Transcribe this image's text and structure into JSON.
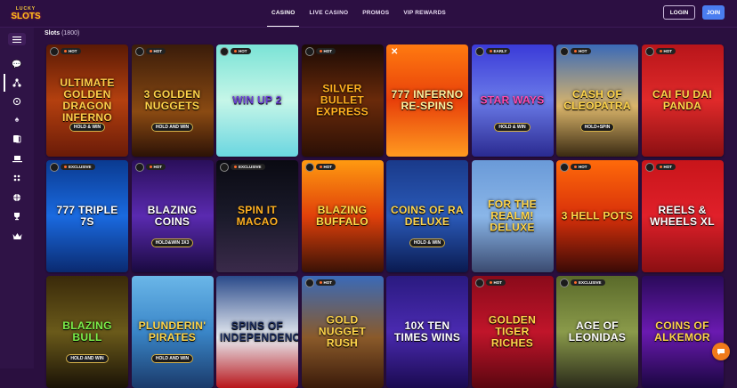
{
  "logo": {
    "line1": "LUCKY",
    "line2": "SLOTS"
  },
  "nav": {
    "items": [
      "CASINO",
      "LIVE CASINO",
      "PROMOS",
      "VIP REWARDS"
    ]
  },
  "auth": {
    "login": "LOGIN",
    "join": "JOIN"
  },
  "sidebar": {
    "icons": [
      "menu-icon",
      "chat-bubbles-icon",
      "slots-tree-icon",
      "ball-icon",
      "spade-icon",
      "cards-icon",
      "laptop-icon",
      "dice-icon",
      "basketball-icon",
      "trophy-icon",
      "crown-icon"
    ]
  },
  "section": {
    "title": "Slots",
    "count": "(1800)"
  },
  "tiles": [
    {
      "title": "Ultimate Golden Dragon Inferno",
      "sub": "HOLD & WIN",
      "tag": "HOT",
      "bg": "linear-gradient(180deg,#5a1a05,#b4400f 50%,#6a1b08)",
      "color": "#ffcf4a"
    },
    {
      "title": "3 Golden Nuggets",
      "sub": "HOLD AND WIN",
      "tag": "HOT",
      "bg": "linear-gradient(180deg,#3a1c0a,#8a4a12 60%,#2c1206)",
      "color": "#ffd54a"
    },
    {
      "title": "Win Up 2",
      "sub": "",
      "tag": "HOT",
      "bg": "linear-gradient(180deg,#7ae3d6,#c6f6e8 50%,#6ad6e0)",
      "color": "#6a3fd8"
    },
    {
      "title": "Silver Bullet Express",
      "sub": "",
      "tag": "HOT",
      "bg": "linear-gradient(180deg,#1a0a05,#6a2a0a 50%,#2a0f05)",
      "color": "#ffb020"
    },
    {
      "title": "777 Inferno Re-Spins",
      "sub": "",
      "tag": "",
      "bg": "linear-gradient(180deg,#ff7a10,#e8400a 50%,#ff9a20)",
      "color": "#fff2a0"
    },
    {
      "title": "Star Ways",
      "sub": "HOLD & WIN",
      "tag": "EARLY",
      "bg": "linear-gradient(180deg,#3a3ad8,#6a7ae8 50%,#2a2a90)",
      "color": "#ff4ab0"
    },
    {
      "title": "Cash of Cleopatra",
      "sub": "HOLD+SPIN",
      "tag": "HOT",
      "bg": "linear-gradient(180deg,#3a6ab8,#d9b46a 55%,#3a2a12)",
      "color": "#ffd54a"
    },
    {
      "title": "Cai Fu Dai Panda",
      "sub": "",
      "tag": "HOT",
      "bg": "linear-gradient(180deg,#b8151a,#e02a2a 50%,#8a0f12)",
      "color": "#ffd54a"
    },
    {
      "title": "777 Triple 7s",
      "sub": "",
      "tag": "EXCLUSIVE",
      "bg": "linear-gradient(180deg,#0a3a90,#1a6ae0 50%,#0a2a70)",
      "color": "#ffffff"
    },
    {
      "title": "Blazing Coins",
      "sub": "HOLD&WIN 3X3",
      "tag": "HOT",
      "bg": "linear-gradient(180deg,#2a0f5a,#5a2ab0 50%,#1a0a40)",
      "color": "#ffffff"
    },
    {
      "title": "Spin It Macao",
      "sub": "",
      "tag": "EXCLUSIVE",
      "bg": "linear-gradient(180deg,#0a0a12,#1a1a2a 50%,#3a2a4a)",
      "color": "#ffb020"
    },
    {
      "title": "Blazing Buffalo",
      "sub": "",
      "tag": "HOT",
      "bg": "linear-gradient(180deg,#ff9a10,#e0400a 50%,#3a1206)",
      "color": "#ffdf4a"
    },
    {
      "title": "Coins of Ra Deluxe",
      "sub": "HOLD & WIN",
      "tag": "",
      "bg": "linear-gradient(180deg,#1a3a8a,#2a5ab8 50%,#0a1a50)",
      "color": "#ffd54a"
    },
    {
      "title": "For the Realm! Deluxe",
      "sub": "",
      "tag": "",
      "bg": "linear-gradient(180deg,#6a9ad8,#8ab6e8 50%,#3a4a70)",
      "color": "#ffd54a"
    },
    {
      "title": "3 Hell Pots",
      "sub": "",
      "tag": "HOT",
      "bg": "linear-gradient(180deg,#ff6a0a,#d8300a 50%,#3a0a06)",
      "color": "#ffd54a"
    },
    {
      "title": "Reels & Wheels XL",
      "sub": "",
      "tag": "HOT",
      "bg": "linear-gradient(180deg,#c8151a,#e0202a 50%,#8a0f12)",
      "color": "#ffffff"
    },
    {
      "title": "Blazing Bull",
      "sub": "HOLD AND WIN",
      "tag": "",
      "bg": "linear-gradient(180deg,#3a2a0a,#6a5a1a 50%,#1a1206)",
      "color": "#7aef4a"
    },
    {
      "title": "Plunderin' Pirates",
      "sub": "HOLD AND WIN",
      "tag": "",
      "bg": "linear-gradient(180deg,#6ab6e8,#3a86c8 50%,#1a3a6a)",
      "color": "#ffd54a"
    },
    {
      "title": "Spins of Independence",
      "sub": "",
      "tag": "",
      "bg": "linear-gradient(180deg,#2a4a8a,#e8ecf2 55%,#b8151a)",
      "color": "#1a2a5a"
    },
    {
      "title": "Gold Nugget Rush",
      "sub": "",
      "tag": "HOT",
      "bg": "linear-gradient(180deg,#3a6ab8,#8a5a2a 55%,#3a1a0a)",
      "color": "#ffd54a"
    },
    {
      "title": "10x Ten Times Wins",
      "sub": "",
      "tag": "",
      "bg": "linear-gradient(180deg,#2a1a80,#4a2ab0 50%,#1a0a50)",
      "color": "#ffffff"
    },
    {
      "title": "Golden Tiger Riches",
      "sub": "",
      "tag": "HOT",
      "bg": "linear-gradient(180deg,#8a0a1a,#c0152a 50%,#5a0610)",
      "color": "#ffd54a"
    },
    {
      "title": "Age of Leonidas",
      "sub": "",
      "tag": "EXCLUSIVE",
      "bg": "linear-gradient(180deg,#5a6a2a,#8a9a4a 50%,#2a2a1a)",
      "color": "#ffffff"
    },
    {
      "title": "Coins of Alkemor",
      "sub": "",
      "tag": "",
      "bg": "linear-gradient(180deg,#2a0a5a,#6a1ab0 50%,#1a0640)",
      "color": "#ffd54a"
    }
  ]
}
